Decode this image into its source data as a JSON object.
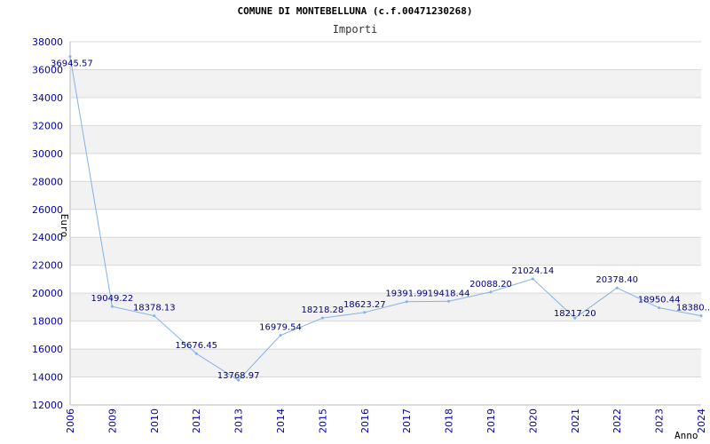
{
  "chart_data": {
    "type": "line",
    "title": "COMUNE DI MONTEBELLUNA (c.f.00471230268)",
    "subtitle": "Importi",
    "xlabel": "Anno",
    "ylabel": "Euro",
    "ylim": [
      12000,
      38000
    ],
    "y_ticks": [
      "12000",
      "14000",
      "16000",
      "18000",
      "20000",
      "22000",
      "24000",
      "26000",
      "28000",
      "30000",
      "32000",
      "34000",
      "36000",
      "38000"
    ],
    "grid": true,
    "categories": [
      "2006",
      "2009",
      "2010",
      "2012",
      "2013",
      "2014",
      "2015",
      "2016",
      "2017",
      "2018",
      "2019",
      "2020",
      "2021",
      "2022",
      "2023",
      "2024"
    ],
    "values": [
      36945.57,
      19049.22,
      18378.13,
      15676.45,
      13768.97,
      16979.54,
      18218.28,
      18623.27,
      19391.99,
      19418.44,
      20088.2,
      21024.14,
      18217.2,
      20378.4,
      18950.44,
      18380.0
    ],
    "data_labels": [
      "36945.57",
      "19049.22",
      "18378.13",
      "15676.45",
      "13768.97",
      "16979.54",
      "18218.28",
      "18623.27",
      "19391.99",
      "19418.44",
      "20088.20",
      "21024.14",
      "18217.20",
      "20378.40",
      "18950.44",
      "18380.."
    ],
    "colors": {
      "line": "#7fb2e8",
      "axis_text": "#0000b0",
      "label_text": "#000080",
      "band": "#f2f2f2",
      "grid": "#d8d8d8",
      "title_text": "#000000"
    }
  }
}
